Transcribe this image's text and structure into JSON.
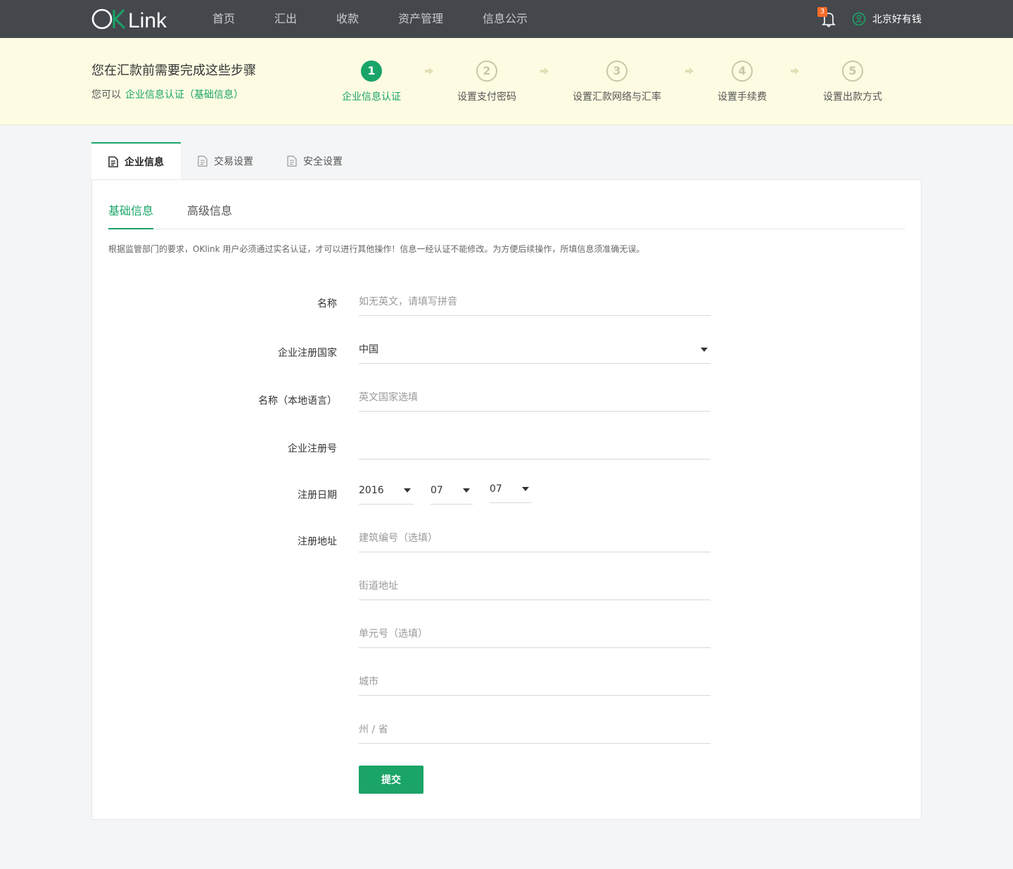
{
  "brand": {
    "logo_text": "OKLink",
    "accent": "#1aa468",
    "nav_bg": "#44474c",
    "banner_bg": "#fdfbe2"
  },
  "nav": {
    "items": [
      "首页",
      "汇出",
      "收款",
      "资产管理",
      "信息公示"
    ],
    "notification_count": "3",
    "user_name": "北京好有钱"
  },
  "banner": {
    "title": "您在汇款前需要完成这些步骤",
    "subtitle_prefix": "您可以",
    "subtitle_link": "企业信息认证（基础信息）",
    "steps": [
      {
        "number": "1",
        "label": "企业信息认证",
        "active": true
      },
      {
        "number": "2",
        "label": "设置支付密码",
        "active": false
      },
      {
        "number": "3",
        "label": "设置汇款网络与汇率",
        "active": false
      },
      {
        "number": "4",
        "label": "设置手续费",
        "active": false
      },
      {
        "number": "5",
        "label": "设置出款方式",
        "active": false
      }
    ]
  },
  "tabs": [
    "企业信息",
    "交易设置",
    "安全设置"
  ],
  "subtabs": [
    "基础信息",
    "高级信息"
  ],
  "notice": "根据监管部门的要求，OKlink 用户必须通过实名认证，才可以进行其他操作！信息一经认证不能修改。为方便后续操作，所填信息须准确无误。",
  "form": {
    "name_label": "名称",
    "name_placeholder": "如无英文，请填写拼音",
    "country_label": "企业注册国家",
    "country_value": "中国",
    "local_name_label": "名称（本地语言）",
    "local_name_placeholder": "英文国家选填",
    "reg_no_label": "企业注册号",
    "reg_no_value": "",
    "date_label": "注册日期",
    "date_year": "2016",
    "date_month": "07",
    "date_day": "07",
    "address_label": "注册地址",
    "address_building_placeholder": "建筑编号（选填）",
    "address_street_placeholder": "街道地址",
    "address_unit_placeholder": "单元号（选填）",
    "address_city_placeholder": "城市",
    "address_state_placeholder": "州 / 省",
    "submit_label": "提交"
  }
}
